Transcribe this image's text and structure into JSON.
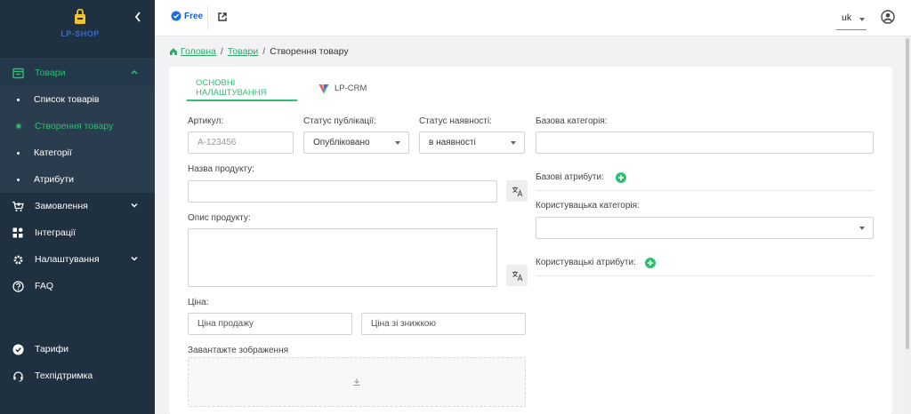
{
  "brand": {
    "logo_text": "LP-SHOP"
  },
  "sidebar": {
    "goods": {
      "label": "Товари",
      "icon": "catalog-icon"
    },
    "goods_sub": [
      {
        "label": "Список товарів"
      },
      {
        "label": "Створення товару"
      },
      {
        "label": "Категорії"
      },
      {
        "label": "Атрибути"
      }
    ],
    "orders": {
      "label": "Замовлення",
      "icon": "cart-icon"
    },
    "integrations": {
      "label": "Інтеграції",
      "icon": "apps-icon"
    },
    "settings": {
      "label": "Налаштування",
      "icon": "gear-icon"
    },
    "faq": {
      "label": "FAQ",
      "icon": "help-icon"
    },
    "tariffs": {
      "label": "Тарифи",
      "icon": "badge-check-icon"
    },
    "support": {
      "label": "Техпідтримка",
      "icon": "headset-icon"
    }
  },
  "topbar": {
    "plan_label": "Free",
    "language": "uk"
  },
  "breadcrumb": {
    "home": "Головна",
    "goods": "Товари",
    "current": "Створення товару"
  },
  "tabs": {
    "main": "ОСНОВНІ НАЛАШТУВАННЯ",
    "lpcrm": "LP-CRM"
  },
  "form": {
    "sku_label": "Артикул:",
    "sku_placeholder": "A-123456",
    "pub_status_label": "Статус публікації:",
    "pub_status_value": "Опубліковано",
    "stock_status_label": "Статус наявності:",
    "stock_status_value": "в наявності",
    "base_category_label": "Базова категорія:",
    "name_label": "Назва продукту:",
    "base_attrs_label": "Базові атрибути:",
    "user_category_label": "Користувацька категорія:",
    "desc_label": "Опис продукту:",
    "user_attrs_label": "Користувацькі атрибути:",
    "price_label": "Ціна:",
    "sale_price_placeholder": "Ціна продажу",
    "discount_price_placeholder": "Ціна зі знижкою",
    "upload_label": "Завантажте зображення"
  },
  "colors": {
    "sidebar_bg": "#1f3040",
    "accent_green": "#2fbf71",
    "brand_blue": "#1d5fb7"
  }
}
